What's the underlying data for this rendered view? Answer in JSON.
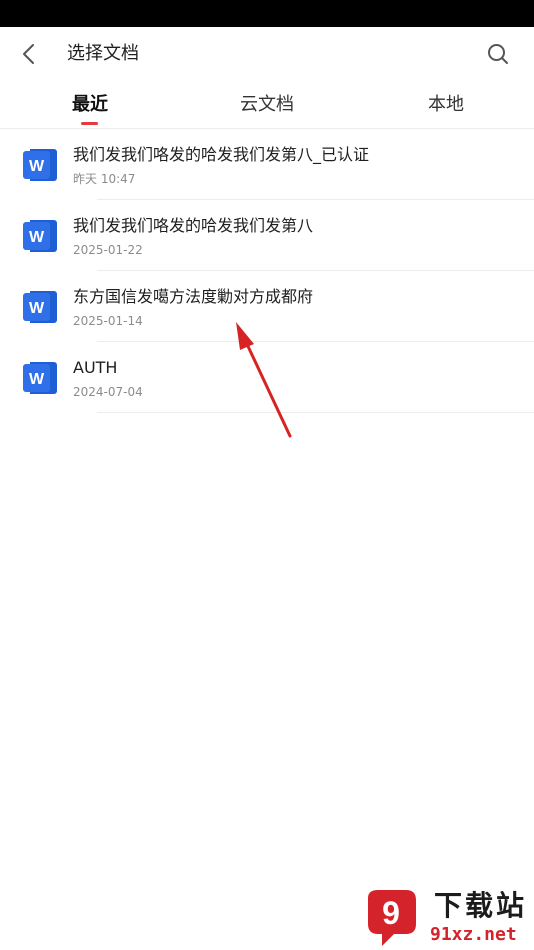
{
  "header": {
    "title": "选择文档",
    "back_icon": "chevron-left-icon",
    "search_icon": "search-icon"
  },
  "tabs": [
    {
      "label": "最近",
      "active": true
    },
    {
      "label": "云文档",
      "active": false
    },
    {
      "label": "本地",
      "active": false
    }
  ],
  "files": [
    {
      "name": "我们发我们咯发的哈发我们发第八_已认证",
      "date": "昨天 10:47",
      "icon": "word-file-icon",
      "icon_letter": "W"
    },
    {
      "name": "我们发我们咯发的哈发我们发第八",
      "date": "2025-01-22",
      "icon": "word-file-icon",
      "icon_letter": "W"
    },
    {
      "name": "东方国信发噶方法度勦对方成都府",
      "date": "2025-01-14",
      "icon": "word-file-icon",
      "icon_letter": "W"
    },
    {
      "name": "AUTH",
      "date": "2024-07-04",
      "icon": "word-file-icon",
      "icon_letter": "W"
    }
  ],
  "watermark": {
    "title": "下载站",
    "url": "91xz.net",
    "logo_text": "9"
  },
  "colors": {
    "accent": "#e63b3b",
    "word_blue": "#2f6fe8",
    "arrow": "#d62424",
    "watermark_red": "#d5232b"
  }
}
